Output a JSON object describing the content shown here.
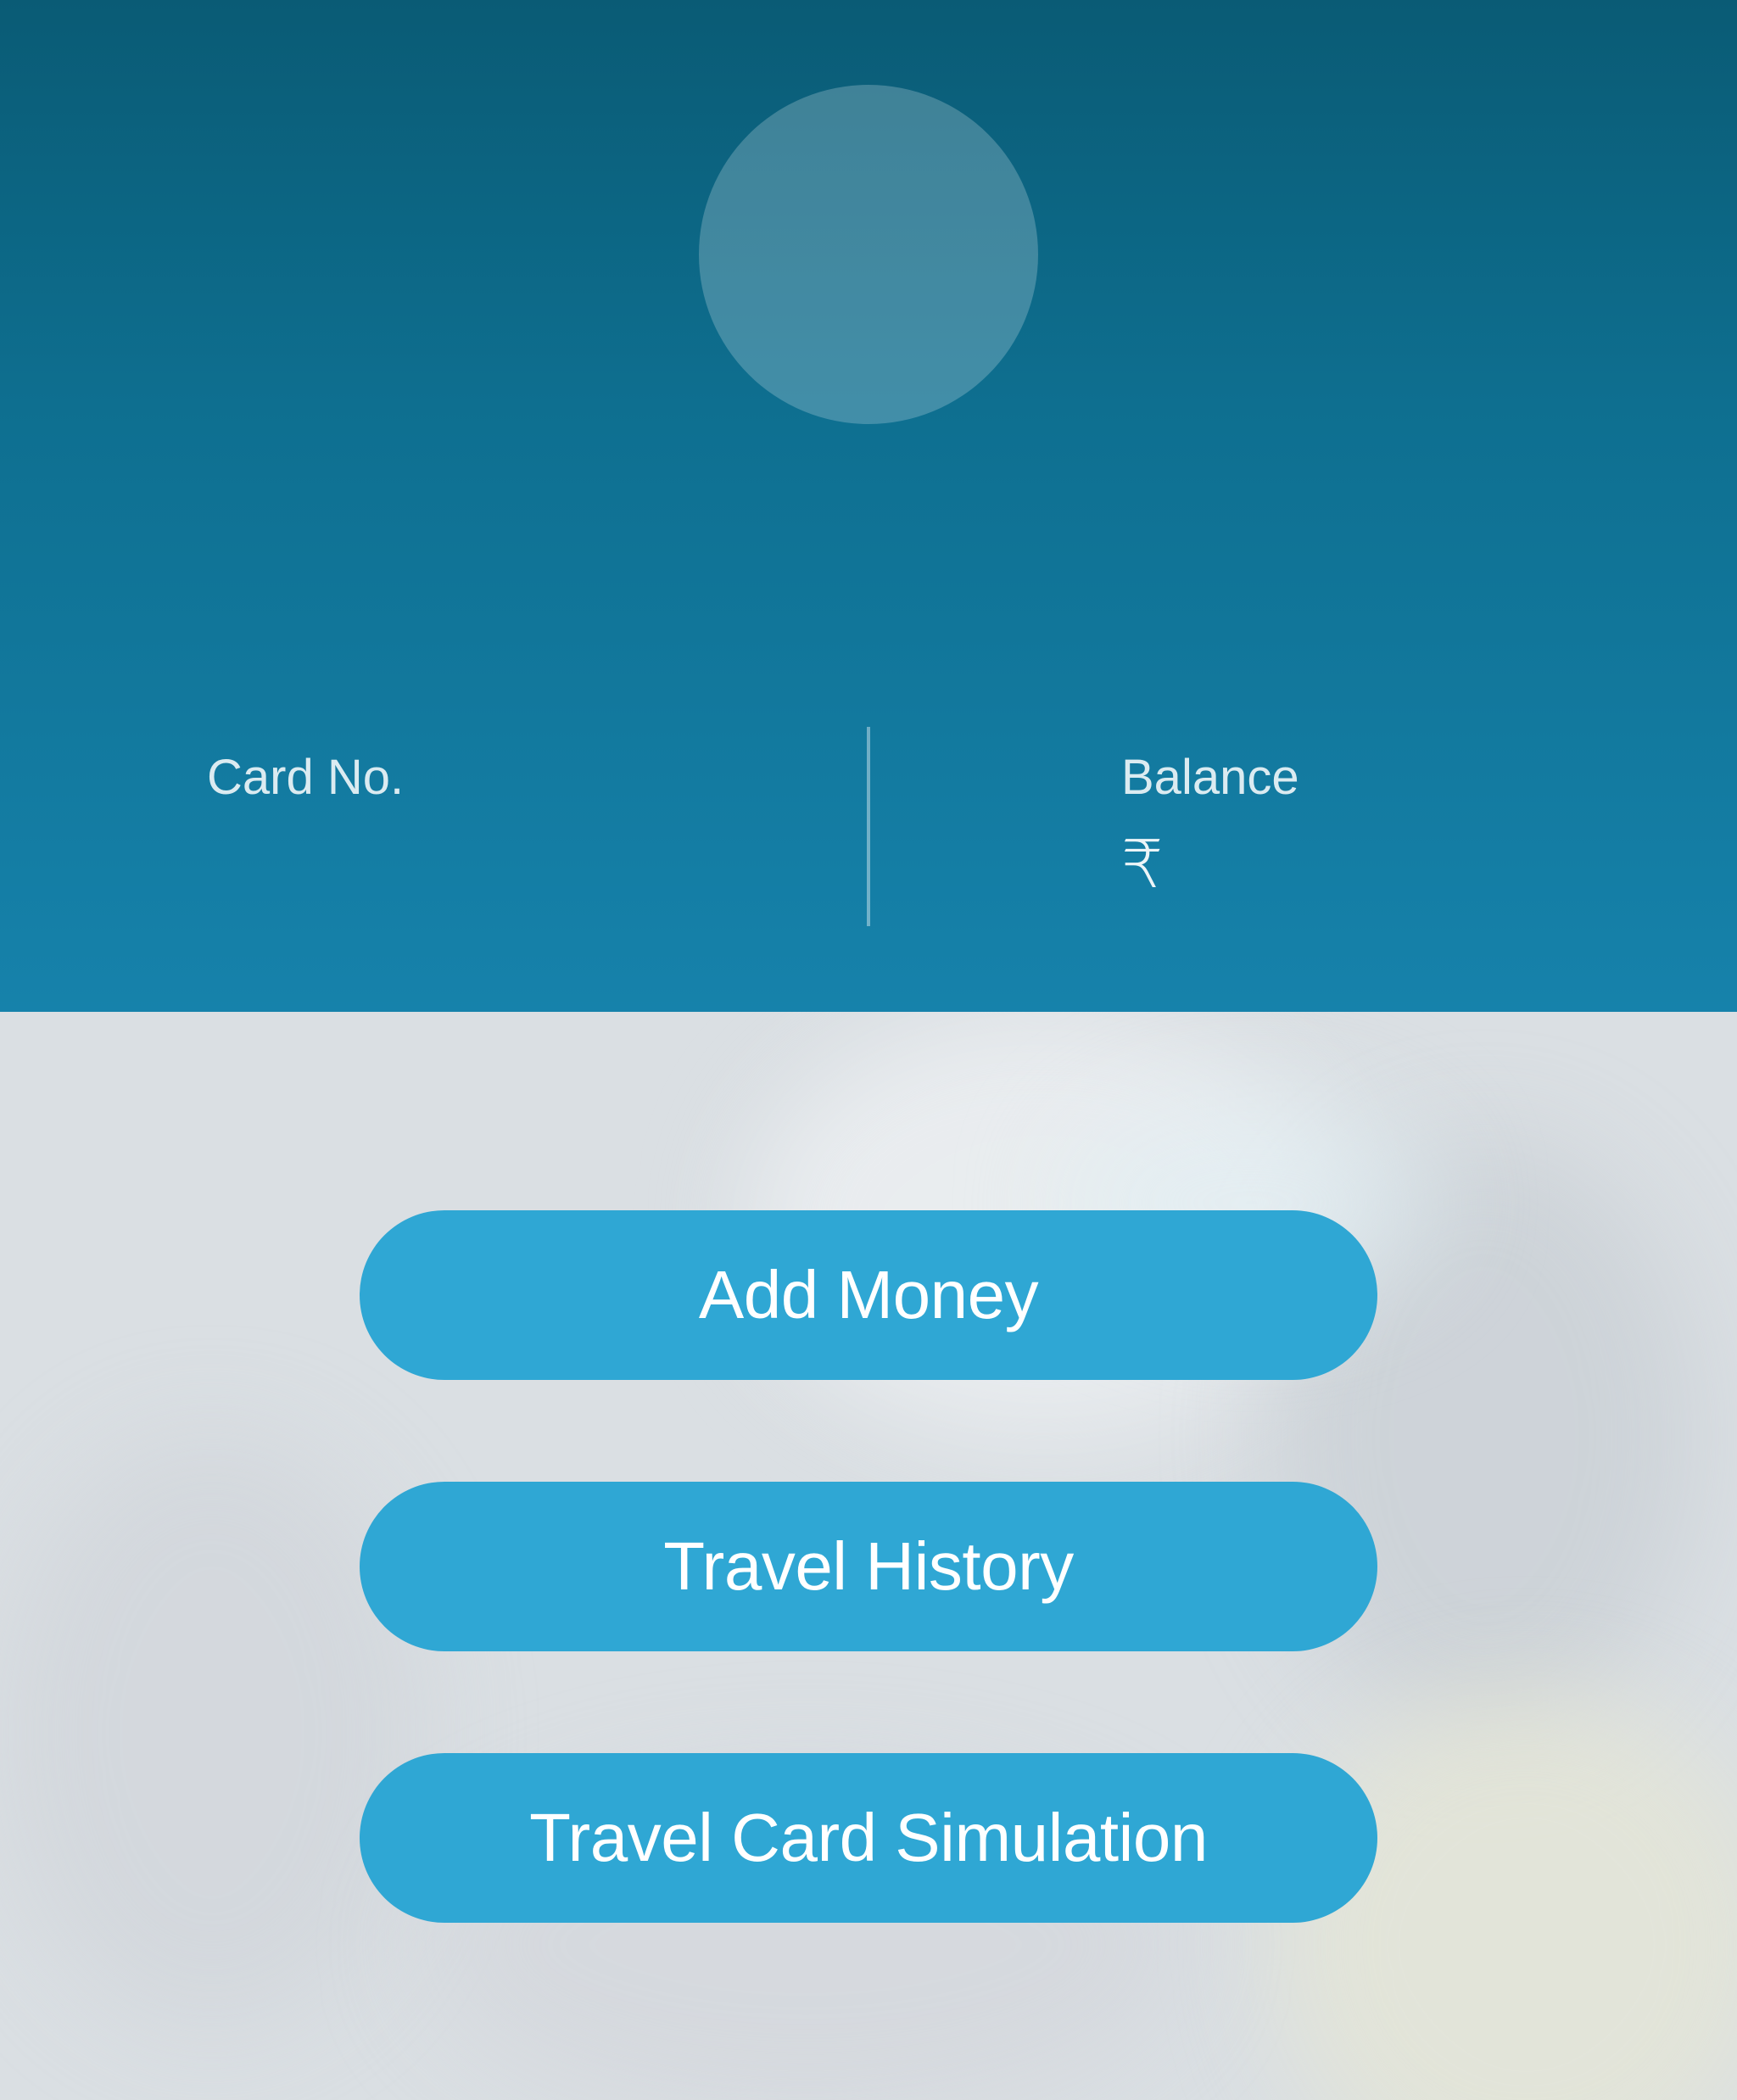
{
  "header": {
    "card_label": "Card No.",
    "balance_label": "Balance",
    "currency_symbol": "₹"
  },
  "actions": {
    "add_money": "Add Money",
    "travel_history": "Travel History",
    "travel_card_simulation": "Travel Card Simulation"
  },
  "colors": {
    "header_top": "#0a5b75",
    "header_bottom": "#1682ab",
    "button": "#2fa7d4",
    "background": "#dadfe3"
  }
}
